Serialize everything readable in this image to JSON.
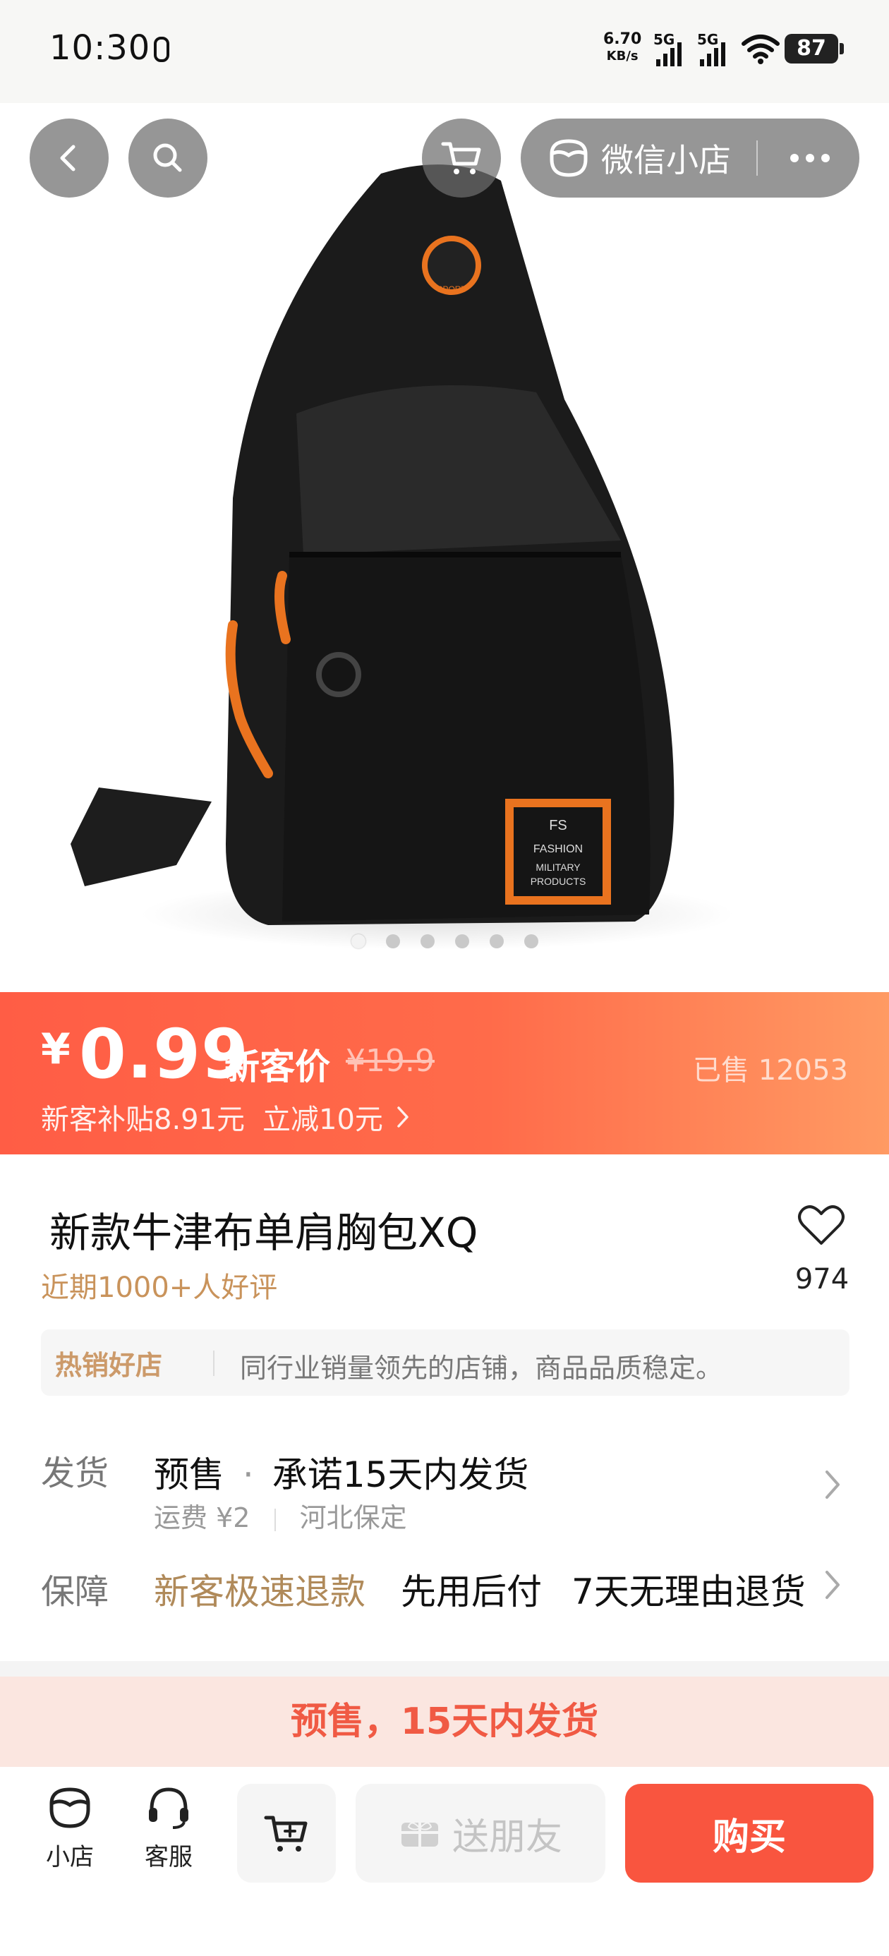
{
  "status_bar": {
    "time": "10:30",
    "net_speed_value": "6.70",
    "net_speed_unit": "KB/s",
    "sim1": "5G",
    "sim2": "5G",
    "battery": "87"
  },
  "header": {
    "shop_entry_label": "微信小店"
  },
  "gallery": {
    "image_count": 6,
    "active_index": 0,
    "patch_text": [
      "FS",
      "FASHION",
      "MILITARY",
      "PRODUCTS"
    ],
    "tag_text": "SPORT"
  },
  "price": {
    "currency": "¥",
    "value": "0.99",
    "tag": "新客价",
    "original": "¥19.9",
    "sold": "已售 12053",
    "subsidy": "新客补贴8.91元",
    "discount": "立减10元"
  },
  "product": {
    "title": "新款牛津布单肩胸包XQ",
    "favorites": "974",
    "reviews": "近期1000+人好评"
  },
  "shop_banner": {
    "badge": "热销好店",
    "description": "同行业销量领先的店铺，商品品质稳定。"
  },
  "shipping": {
    "label": "发货",
    "mode": "预售",
    "promise": "承诺15天内发货",
    "fee": "运费 ¥2",
    "origin": "河北保定"
  },
  "guarantee": {
    "label": "保障",
    "items": [
      "新客极速退款",
      "先用后付",
      "7天无理由退货"
    ]
  },
  "presale_notice": "预售，15天内发货",
  "bottom_bar": {
    "shop_label": "小店",
    "service_label": "客服",
    "gift_label": "送朋友",
    "buy_label": "购买"
  },
  "colors": {
    "accent": "#f9553f",
    "price_gradient_start": "#ff5d45",
    "price_gradient_end": "#ff9a63",
    "gold": "#c9935b"
  }
}
